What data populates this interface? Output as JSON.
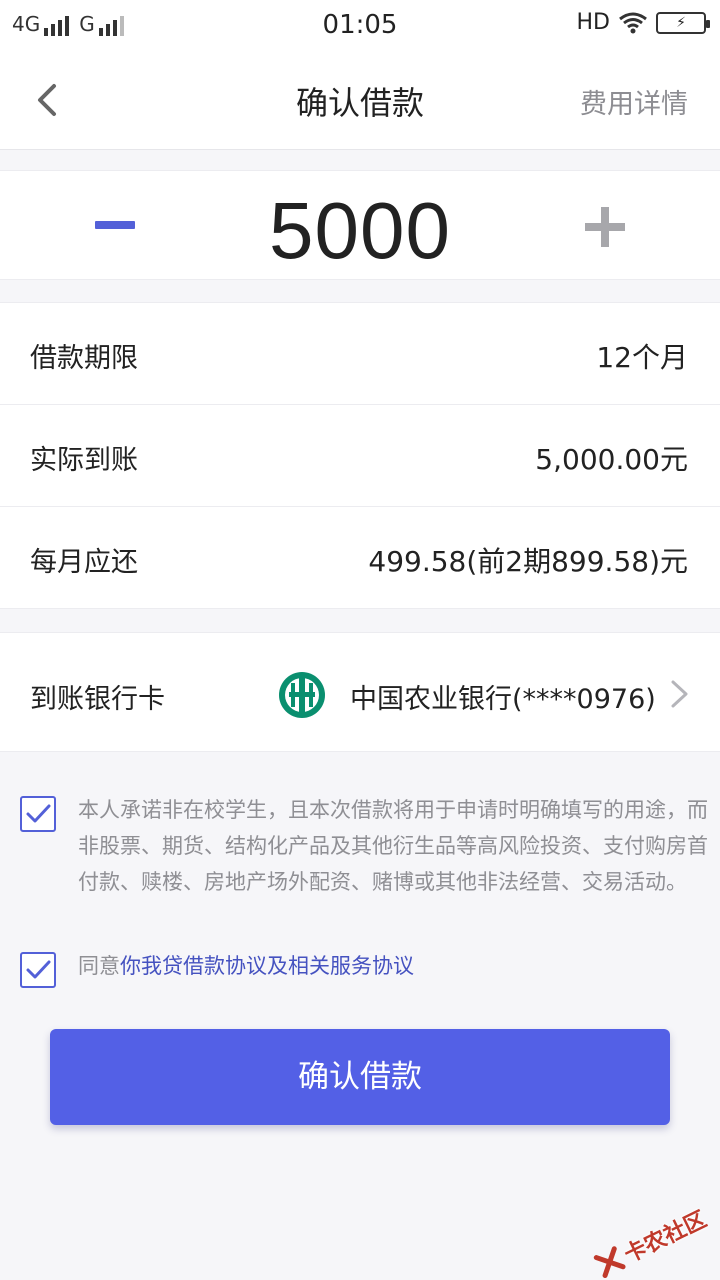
{
  "status_bar": {
    "network1": "4G",
    "network2": "G",
    "time": "01:05",
    "hd": "HD"
  },
  "nav": {
    "title": "确认借款",
    "fee_details": "费用详情"
  },
  "amount": {
    "value": "5000"
  },
  "details": [
    {
      "label": "借款期限",
      "value": "12个月"
    },
    {
      "label": "实际到账",
      "value": "5,000.00元"
    },
    {
      "label": "每月应还",
      "value": "499.58(前2期899.58)元"
    }
  ],
  "bank": {
    "label": "到账银行卡",
    "name": "中国农业银行(****0976)"
  },
  "agreements": {
    "commitment": "本人承诺非在校学生，且本次借款将用于申请时明确填写的用途，而非股票、期货、结构化产品及其他衍生品等高风险投资、支付购房首付款、赎楼、房地产场外配资、赌博或其他非法经营、交易活动。",
    "agree_prefix": "同意",
    "agree_link": "你我贷借款协议及相关服务协议"
  },
  "confirm_button": "确认借款",
  "watermark": "卡农社区",
  "colors": {
    "accent": "#5360e6",
    "bank_green": "#0a8f6f"
  }
}
